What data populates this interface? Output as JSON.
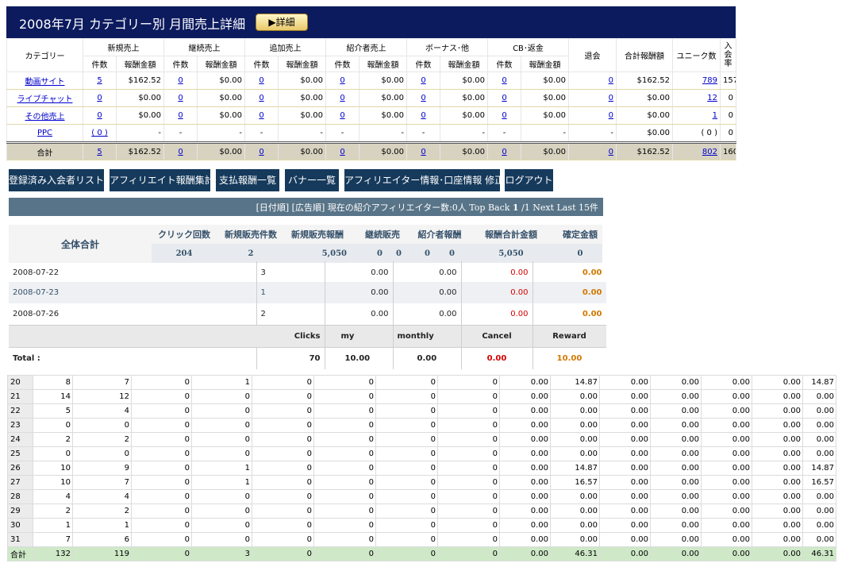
{
  "report": {
    "title": "2008年7月 カテゴリー別 月間売上詳細",
    "detail_button": "▶詳細",
    "group_headers": [
      "新規売上",
      "継続売上",
      "追加売上",
      "紹介者売上",
      "ボーナス･他",
      "CB･返金"
    ],
    "col_category": "カテゴリー",
    "col_count": "件数",
    "col_amount": "報酬金額",
    "col_withdraw": "退会",
    "col_total": "合計報酬額",
    "col_unique": "ユニーク数",
    "col_rate": "入会率",
    "rows": [
      {
        "name": "動画サイト",
        "cells": [
          "5",
          "$162.52",
          "0",
          "$0.00",
          "0",
          "$0.00",
          "0",
          "$0.00",
          "0",
          "$0.00",
          "0",
          "$0.00"
        ],
        "withdraw": "0",
        "total": "$162.52",
        "unique": "789",
        "rate": "157"
      },
      {
        "name": "ライブチャット",
        "cells": [
          "0",
          "$0.00",
          "0",
          "$0.00",
          "0",
          "$0.00",
          "0",
          "$0.00",
          "0",
          "$0.00",
          "0",
          "$0.00"
        ],
        "withdraw": "0",
        "total": "$0.00",
        "unique": "12",
        "rate": "0"
      },
      {
        "name": "その他売上",
        "cells": [
          "0",
          "$0.00",
          "0",
          "$0.00",
          "0",
          "$0.00",
          "0",
          "$0.00",
          "0",
          "$0.00",
          "0",
          "$0.00"
        ],
        "withdraw": "0",
        "total": "$0.00",
        "unique": "1",
        "rate": "0"
      },
      {
        "name": "PPC",
        "cells": [
          "( 0 )",
          "-",
          "-",
          "-",
          "-",
          "-",
          "-",
          "-",
          "-",
          "-",
          "-",
          "-"
        ],
        "withdraw": "-",
        "total": "$0.00",
        "unique": "( 0 )",
        "rate": "0"
      }
    ],
    "total": {
      "label": "合計",
      "cells": [
        "5",
        "$162.52",
        "0",
        "$0.00",
        "0",
        "$0.00",
        "0",
        "$0.00",
        "0",
        "$0.00",
        "0",
        "$0.00"
      ],
      "withdraw": "0",
      "total": "$162.52",
      "unique": "802",
      "rate": "160"
    }
  },
  "nav": {
    "items": [
      "登録済み入会者リスト",
      "アフィリエイト報酬集計",
      "支払報酬一覧",
      "バナー一覧",
      "アフィリエイター情報･口座情報 修正",
      "ログアウト"
    ]
  },
  "pager": {
    "text": "[日付順] [広告順]  現在の紹介アフィリエイター数:0人",
    "top": "Top",
    "back": "Back",
    "page": "1",
    "of": "/1",
    "next": "Next",
    "last": "Last",
    "count": "15件"
  },
  "summary": {
    "label": "全体合計",
    "headers": [
      "クリック回数",
      "新規販売件数",
      "新規販売報酬",
      "継続販売",
      "紹介者報酬",
      "報酬合計金額",
      "確定金額"
    ],
    "values": [
      "204",
      "2",
      "5,050",
      "0",
      "0",
      "0",
      "0",
      "5,050",
      "0"
    ]
  },
  "daily": {
    "rows": [
      {
        "date": "2008-07-22",
        "clicks": "3",
        "my": "0.00",
        "monthly": "0.00",
        "cancel": "0.00",
        "reward": "0.00"
      },
      {
        "date": "2008-07-23",
        "clicks": "1",
        "my": "0.00",
        "monthly": "0.00",
        "cancel": "0.00",
        "reward": "0.00"
      },
      {
        "date": "2008-07-26",
        "clicks": "2",
        "my": "0.00",
        "monthly": "0.00",
        "cancel": "0.00",
        "reward": "0.00"
      }
    ],
    "headers": {
      "clicks": "Clicks",
      "my": "my",
      "monthly": "monthly",
      "cancel": "Cancel",
      "reward": "Reward"
    },
    "total": {
      "label": "Total :",
      "clicks": "70",
      "my": "10.00",
      "monthly": "0.00",
      "cancel": "0.00",
      "reward": "10.00"
    }
  },
  "grid": {
    "rows": [
      [
        "20",
        "8",
        "7",
        "0",
        "1",
        "0",
        "0",
        "0",
        "0",
        "0.00",
        "14.87",
        "0.00",
        "0.00",
        "0.00",
        "0.00",
        "14.87"
      ],
      [
        "21",
        "14",
        "12",
        "0",
        "0",
        "0",
        "0",
        "0",
        "0",
        "0.00",
        "0.00",
        "0.00",
        "0.00",
        "0.00",
        "0.00",
        "0.00"
      ],
      [
        "22",
        "5",
        "4",
        "0",
        "0",
        "0",
        "0",
        "0",
        "0",
        "0.00",
        "0.00",
        "0.00",
        "0.00",
        "0.00",
        "0.00",
        "0.00"
      ],
      [
        "23",
        "0",
        "0",
        "0",
        "0",
        "0",
        "0",
        "0",
        "0",
        "0.00",
        "0.00",
        "0.00",
        "0.00",
        "0.00",
        "0.00",
        "0.00"
      ],
      [
        "24",
        "2",
        "2",
        "0",
        "0",
        "0",
        "0",
        "0",
        "0",
        "0.00",
        "0.00",
        "0.00",
        "0.00",
        "0.00",
        "0.00",
        "0.00"
      ],
      [
        "25",
        "0",
        "0",
        "0",
        "0",
        "0",
        "0",
        "0",
        "0",
        "0.00",
        "0.00",
        "0.00",
        "0.00",
        "0.00",
        "0.00",
        "0.00"
      ],
      [
        "26",
        "10",
        "9",
        "0",
        "1",
        "0",
        "0",
        "0",
        "0",
        "0.00",
        "14.87",
        "0.00",
        "0.00",
        "0.00",
        "0.00",
        "14.87"
      ],
      [
        "27",
        "10",
        "7",
        "0",
        "1",
        "0",
        "0",
        "0",
        "0",
        "0.00",
        "16.57",
        "0.00",
        "0.00",
        "0.00",
        "0.00",
        "16.57"
      ],
      [
        "28",
        "4",
        "4",
        "0",
        "0",
        "0",
        "0",
        "0",
        "0",
        "0.00",
        "0.00",
        "0.00",
        "0.00",
        "0.00",
        "0.00",
        "0.00"
      ],
      [
        "29",
        "2",
        "2",
        "0",
        "0",
        "0",
        "0",
        "0",
        "0",
        "0.00",
        "0.00",
        "0.00",
        "0.00",
        "0.00",
        "0.00",
        "0.00"
      ],
      [
        "30",
        "1",
        "1",
        "0",
        "0",
        "0",
        "0",
        "0",
        "0",
        "0.00",
        "0.00",
        "0.00",
        "0.00",
        "0.00",
        "0.00",
        "0.00"
      ],
      [
        "31",
        "7",
        "6",
        "0",
        "0",
        "0",
        "0",
        "0",
        "0",
        "0.00",
        "0.00",
        "0.00",
        "0.00",
        "0.00",
        "0.00",
        "0.00"
      ]
    ],
    "total": [
      "合計",
      "132",
      "119",
      "0",
      "3",
      "0",
      "0",
      "0",
      "0",
      "0.00",
      "46.31",
      "0.00",
      "0.00",
      "0.00",
      "0.00",
      "46.31"
    ]
  }
}
